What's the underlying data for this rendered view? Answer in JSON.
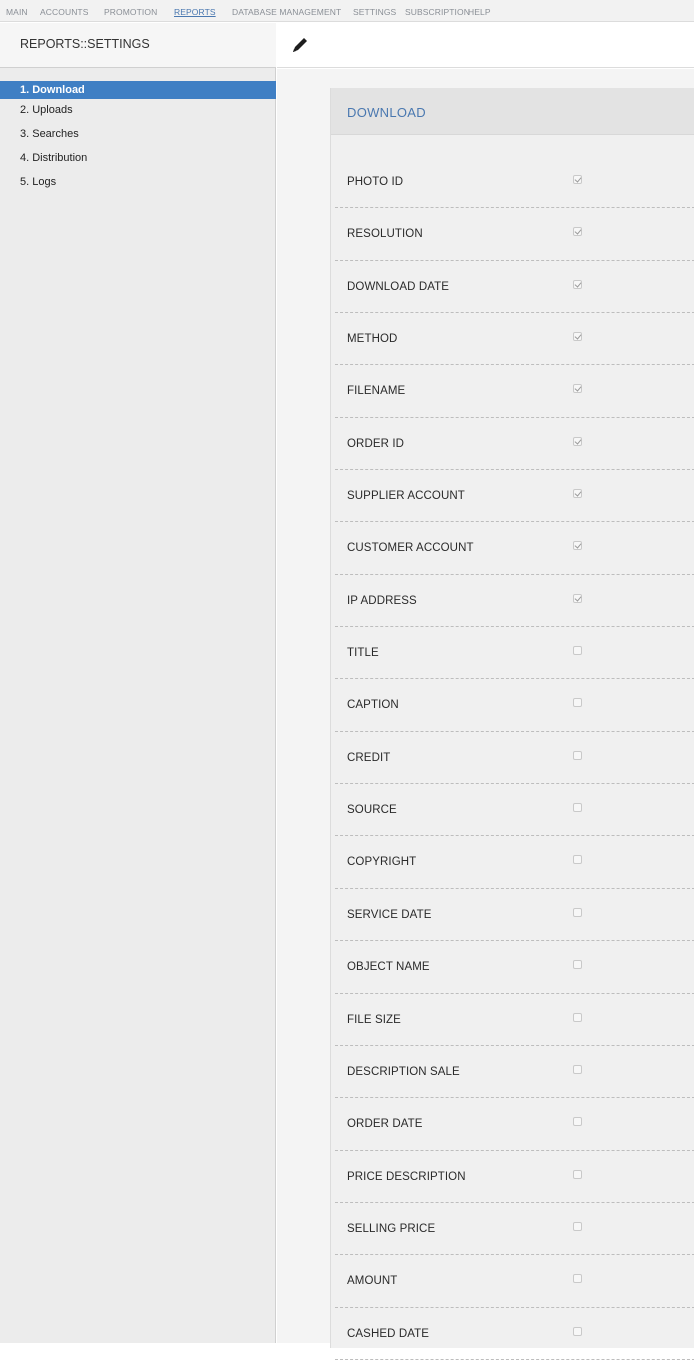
{
  "topnav": {
    "items": [
      "MAIN",
      "ACCOUNTS",
      "PROMOTION",
      "REPORTS",
      "DATABASE MANAGEMENT",
      "SETTINGS",
      "SUBSCRIPTION",
      "HELP"
    ],
    "active_index": 3
  },
  "sidebar": {
    "title": "REPORTS::SETTINGS",
    "items": [
      "1. Download",
      "2. Uploads",
      "3. Searches",
      "4. Distribution",
      "5. Logs"
    ],
    "active_index": 0
  },
  "toolbar": {
    "icon": "pencil-icon"
  },
  "panel": {
    "title": "DOWNLOAD",
    "fields": [
      {
        "label": "PHOTO ID",
        "checked": true
      },
      {
        "label": "RESOLUTION",
        "checked": true
      },
      {
        "label": "DOWNLOAD DATE",
        "checked": true
      },
      {
        "label": "METHOD",
        "checked": true
      },
      {
        "label": "FILENAME",
        "checked": true
      },
      {
        "label": "ORDER ID",
        "checked": true
      },
      {
        "label": "SUPPLIER ACCOUNT",
        "checked": true
      },
      {
        "label": "CUSTOMER ACCOUNT",
        "checked": true
      },
      {
        "label": "IP ADDRESS",
        "checked": true
      },
      {
        "label": "TITLE",
        "checked": false
      },
      {
        "label": "CAPTION",
        "checked": false
      },
      {
        "label": "CREDIT",
        "checked": false
      },
      {
        "label": "SOURCE",
        "checked": false
      },
      {
        "label": "COPYRIGHT",
        "checked": false
      },
      {
        "label": "SERVICE DATE",
        "checked": false
      },
      {
        "label": "OBJECT NAME",
        "checked": false
      },
      {
        "label": "FILE SIZE",
        "checked": false
      },
      {
        "label": "DESCRIPTION SALE",
        "checked": false
      },
      {
        "label": "ORDER DATE",
        "checked": false
      },
      {
        "label": "PRICE DESCRIPTION",
        "checked": false
      },
      {
        "label": "SELLING PRICE",
        "checked": false
      },
      {
        "label": "AMOUNT",
        "checked": false
      },
      {
        "label": "CASHED DATE",
        "checked": false
      }
    ]
  }
}
